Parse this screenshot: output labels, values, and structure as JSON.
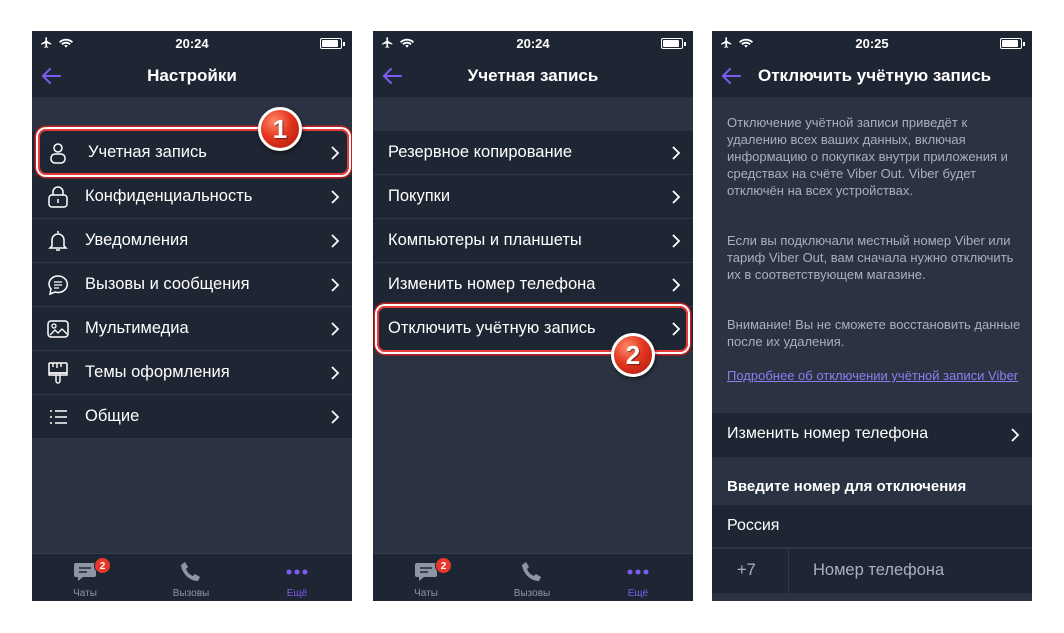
{
  "status": {
    "times": [
      "20:24",
      "20:24",
      "20:25"
    ]
  },
  "screen1": {
    "title": "Настройки",
    "items": [
      {
        "label": "Учетная запись",
        "icon": "person-icon"
      },
      {
        "label": "Конфиденциальность",
        "icon": "lock-icon"
      },
      {
        "label": "Уведомления",
        "icon": "bell-icon"
      },
      {
        "label": "Вызовы и сообщения",
        "icon": "chat-icon"
      },
      {
        "label": "Мультимедиа",
        "icon": "image-icon"
      },
      {
        "label": "Темы оформления",
        "icon": "brush-icon"
      },
      {
        "label": "Общие",
        "icon": "list-icon"
      }
    ],
    "step": "1"
  },
  "screen2": {
    "title": "Учетная запись",
    "items": [
      {
        "label": "Резервное копирование"
      },
      {
        "label": "Покупки"
      },
      {
        "label": "Компьютеры и планшеты"
      },
      {
        "label": "Изменить номер телефона"
      },
      {
        "label": "Отключить учётную запись"
      }
    ],
    "step": "2"
  },
  "screen3": {
    "title": "Отключить учётную запись",
    "para1": "Отключение учётной записи приведёт к удалению всех ваших данных, включая информацию о покупках внутри приложения и средствах на счёте Viber Out. Viber будет отключён на всех устройствах.",
    "para2": "Если вы подключали местный номер Viber или тариф Viber Out, вам сначала нужно отключить их в соответствующем магазине.",
    "para3": "Внимание! Вы не сможете восстановить данные после их удаления.",
    "link": "Подробнее об отключении учётной записи Viber",
    "change_number": "Изменить номер телефона",
    "section": "Введите номер для отключения",
    "country": "Россия",
    "code": "+7",
    "phone_placeholder": "Номер телефона"
  },
  "tabbar": {
    "chats": "Чаты",
    "calls": "Вызовы",
    "more": "Ещё",
    "chats_badge": "2"
  },
  "colors": {
    "background": "#2b3342",
    "bar": "#1f2633",
    "accent": "#7c5cf2",
    "highlight": "#e63b3b"
  }
}
